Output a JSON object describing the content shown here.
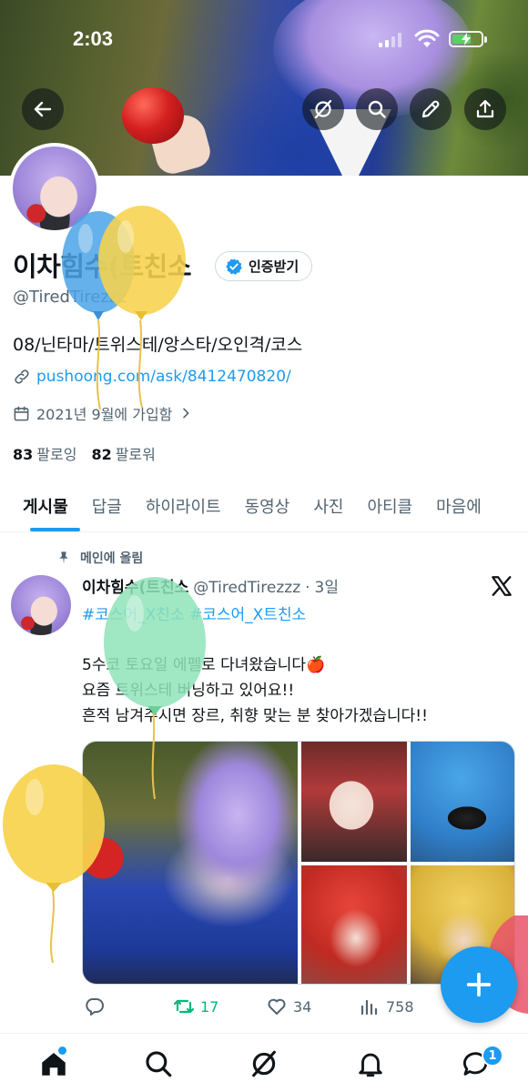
{
  "status_bar": {
    "time": "2:03"
  },
  "profile": {
    "name": "이차힘수(트친소",
    "verify_label": "인증받기",
    "handle": "@TiredTirezzz",
    "bio": "08/닌타마/트위스테/앙스타/오인격/코스",
    "link": "pushoong.com/ask/8412470820/",
    "joined": "2021년 9월에 가입함",
    "following_count": "83",
    "following_label": "팔로잉",
    "followers_count": "82",
    "followers_label": "팔로워"
  },
  "tabs": [
    {
      "label": "게시물",
      "active": true
    },
    {
      "label": "답글"
    },
    {
      "label": "하이라이트"
    },
    {
      "label": "동영상"
    },
    {
      "label": "사진"
    },
    {
      "label": "아티클"
    },
    {
      "label": "마음에"
    }
  ],
  "post": {
    "pinned_label": "메인에 올림",
    "author_name": "이차힘수(트친소",
    "author_handle": "@TiredTirezzz",
    "separator": "·",
    "time": "3일",
    "hashtag_1": "#코스어_X친소",
    "hashtag_2": "#코스어_X트친소",
    "lines": [
      "5수코 토요일 에펠로 다녀왔습니다🍎",
      "요즘 트위스테 버닝하고 있어요!!",
      "흔적 남겨주시면 장르, 취향 맞는 분 찾아가겠습니다!!"
    ],
    "reply_count": "",
    "retweet_count": "17",
    "like_count": "34",
    "view_count": "758"
  },
  "nav": {
    "messages_badge": "1"
  },
  "icons": [
    "back-arrow-icon",
    "grok-icon",
    "search-icon",
    "edit-icon",
    "share-icon",
    "verified-badge-icon",
    "link-icon",
    "calendar-icon",
    "chevron-right-icon",
    "pin-icon",
    "x-logo-icon",
    "reply-icon",
    "retweet-icon",
    "like-icon",
    "views-icon",
    "plus-icon",
    "home-icon",
    "grok-icon",
    "bell-icon",
    "messages-icon"
  ],
  "colors": {
    "accent": "#1d9bf0",
    "retweet": "#00ba7c",
    "text": "#0f1419",
    "muted": "#536471"
  }
}
